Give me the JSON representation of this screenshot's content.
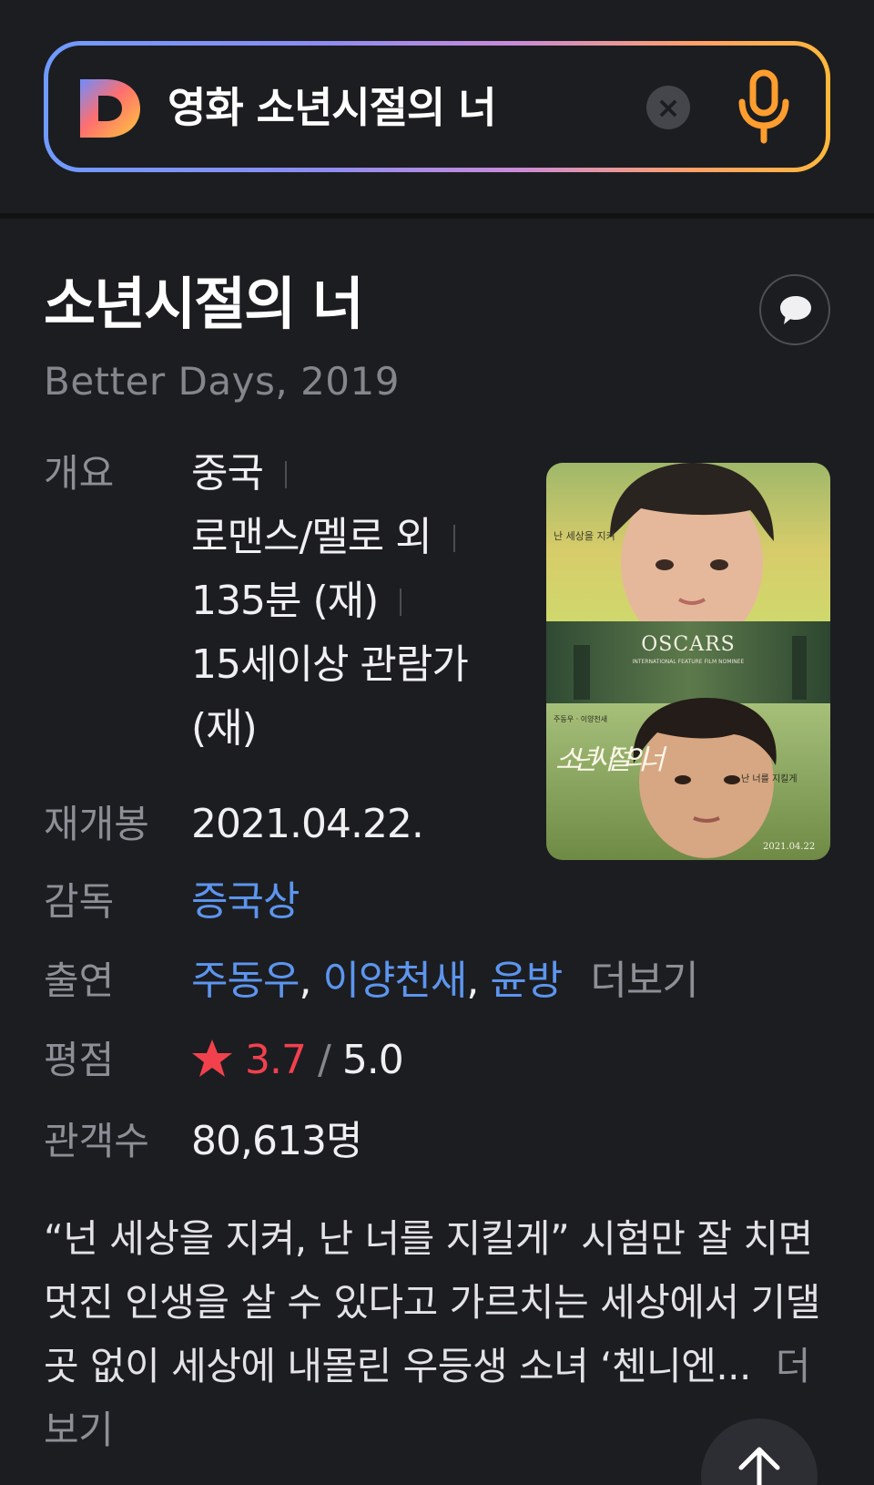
{
  "search": {
    "query": "영화 소년시절의 너",
    "logo": "daum-d-logo",
    "clear_icon": "close-icon",
    "mic_icon": "microphone-icon",
    "accent_colors": [
      "#6f9bff",
      "#c98bd8",
      "#ffb83b"
    ]
  },
  "movie": {
    "title": "소년시절의 너",
    "subtitle": "Better Days, 2019",
    "comment_icon": "speech-bubble-icon"
  },
  "info": {
    "overview": {
      "label": "개요",
      "country": "중국",
      "genre": "로맨스/멜로 외",
      "runtime": "135분 (재)",
      "rating_age_line1": "15세이상 관람가",
      "rating_age_line2": "(재)"
    },
    "rerelease": {
      "label": "재개봉",
      "value": "2021.04.22."
    },
    "director": {
      "label": "감독",
      "value": "증국상"
    },
    "cast": {
      "label": "출연",
      "actors": [
        "주동우",
        "이양천새",
        "윤방"
      ],
      "separator": ",",
      "more": "더보기"
    },
    "rating": {
      "label": "평점",
      "star_icon": "star-icon",
      "score": "3.7",
      "slash": "/",
      "max": "5.0",
      "score_color": "#f1414d"
    },
    "audience": {
      "label": "관객수",
      "value": "80,613명"
    }
  },
  "description": {
    "text": "“넌 세상을 지켜, 난 너를 지킬게” 시험만 잘 치면 멋진 인생을 살 수 있다고 가르치는 세상에서 기댈 곳 없이 세상에 내몰린 우등생 소녀 ‘첸니엔...",
    "more": "더보기"
  },
  "poster": {
    "badge": "OSCARS",
    "badge_sub": "INTERNATIONAL FEATURE FILM NOMINEE",
    "tagline_top": "난 세상을 지켜",
    "tagline_bottom": "난 너를 지킬게",
    "title_calligraphy": "소년 시절의 너",
    "cast_small": "주동우 · 이양천새",
    "date": "2021.04.22"
  },
  "scroll_top_icon": "arrow-up-icon"
}
